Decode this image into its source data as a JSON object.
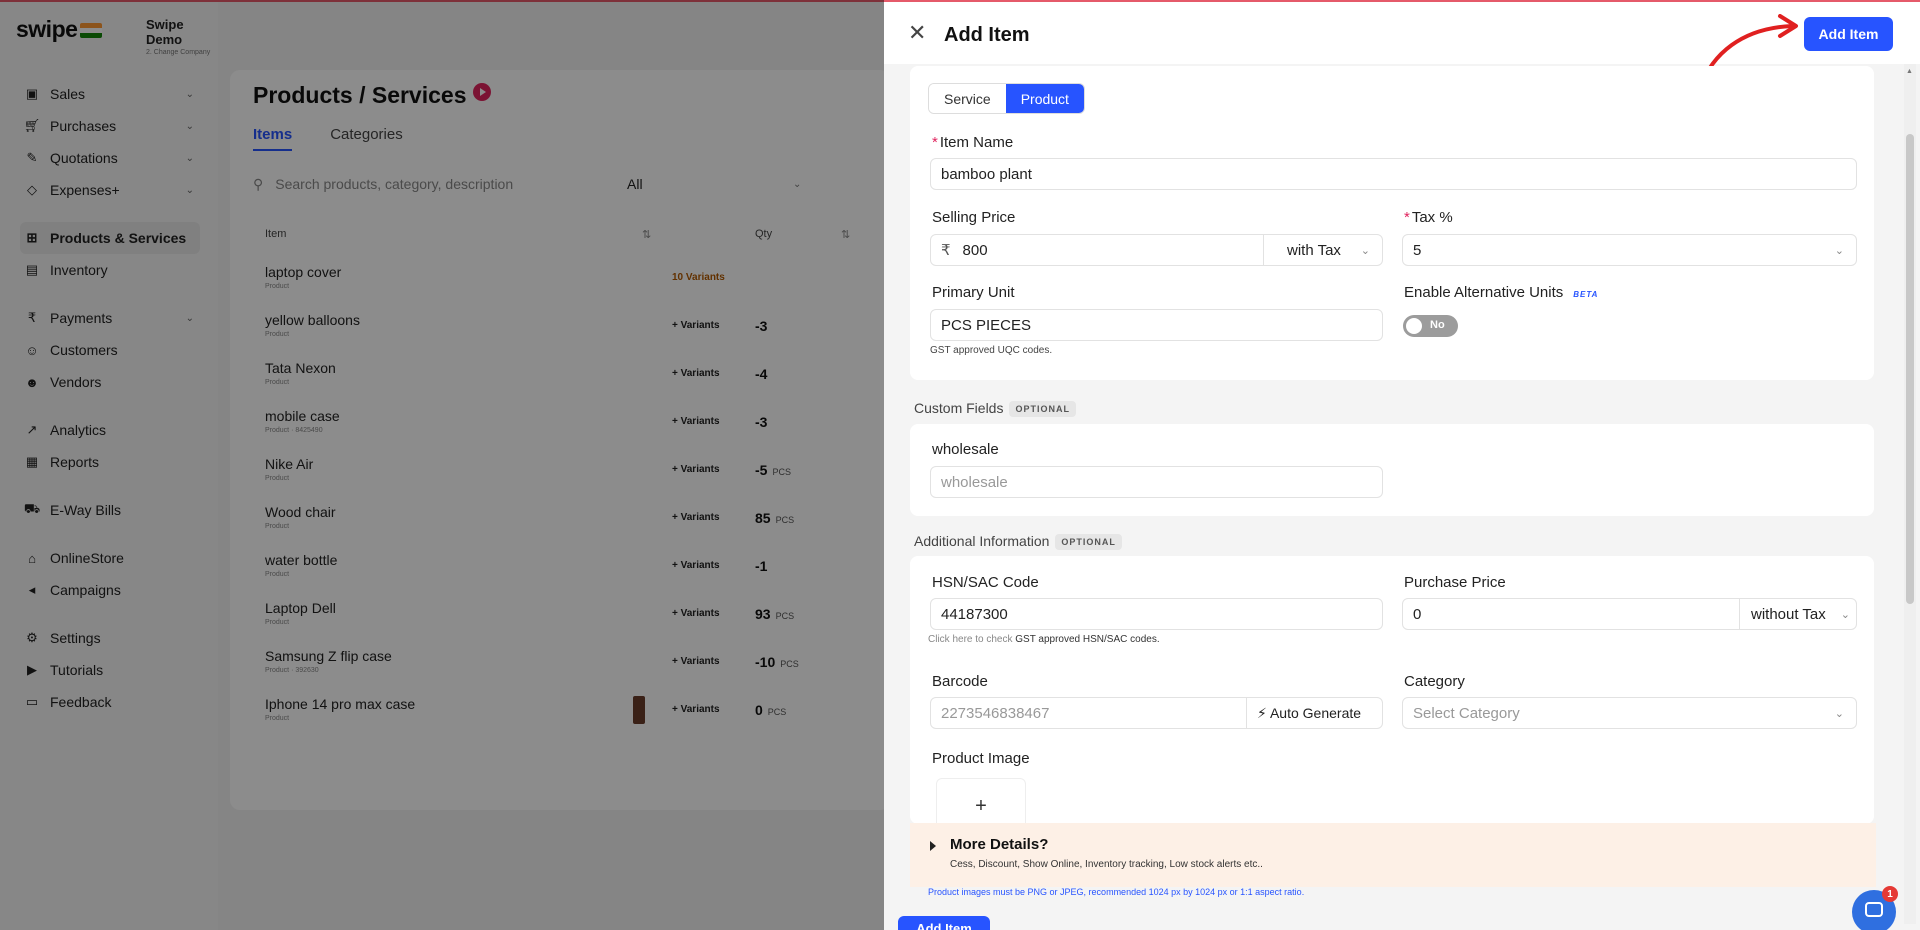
{
  "brand": {
    "logo": "swipe",
    "company_name": "Swipe Demo",
    "company_sub": "2. Change Company"
  },
  "sidebar": {
    "items": [
      {
        "label": "Sales",
        "icon": "sales-icon",
        "expand": true
      },
      {
        "label": "Purchases",
        "icon": "cart-icon",
        "expand": true
      },
      {
        "label": "Quotations",
        "icon": "pen-icon",
        "expand": true
      },
      {
        "label": "Expenses+",
        "icon": "tag-icon",
        "expand": true
      },
      {
        "label": "Products & Services",
        "icon": "products-icon",
        "active": true
      },
      {
        "label": "Inventory",
        "icon": "inventory-icon"
      },
      {
        "label": "Payments",
        "icon": "rupee-icon",
        "expand": true
      },
      {
        "label": "Customers",
        "icon": "user-icon"
      },
      {
        "label": "Vendors",
        "icon": "vendors-icon"
      },
      {
        "label": "Analytics",
        "icon": "analytics-icon"
      },
      {
        "label": "Reports",
        "icon": "reports-icon"
      },
      {
        "label": "E-Way Bills",
        "icon": "truck-icon"
      },
      {
        "label": "OnlineStore",
        "icon": "store-icon"
      },
      {
        "label": "Campaigns",
        "icon": "megaphone-icon"
      },
      {
        "label": "Settings",
        "icon": "gear-icon"
      },
      {
        "label": "Tutorials",
        "icon": "youtube-icon"
      },
      {
        "label": "Feedback",
        "icon": "chat-icon"
      }
    ]
  },
  "products_page": {
    "title": "Products / Services",
    "tabs": [
      "Items",
      "Categories"
    ],
    "search_placeholder": "Search products, category, description",
    "filter_value": "All",
    "columns": {
      "item": "Item",
      "qty": "Qty"
    },
    "rows": [
      {
        "name": "laptop cover",
        "sub": "Product",
        "variants": "10 Variants",
        "qty": "",
        "unit": ""
      },
      {
        "name": "yellow balloons",
        "sub": "Product",
        "variants": "+ Variants",
        "qty": "-3",
        "unit": ""
      },
      {
        "name": "Tata Nexon",
        "sub": "Product",
        "variants": "+ Variants",
        "qty": "-4",
        "unit": ""
      },
      {
        "name": "mobile case",
        "sub": "Product · 8425490",
        "variants": "+ Variants",
        "qty": "-3",
        "unit": ""
      },
      {
        "name": "Nike Air",
        "sub": "Product",
        "variants": "+ Variants",
        "qty": "-5",
        "unit": "PCS"
      },
      {
        "name": "Wood chair",
        "sub": "Product",
        "variants": "+ Variants",
        "qty": "85",
        "unit": "PCS"
      },
      {
        "name": "water bottle",
        "sub": "Product",
        "variants": "+ Variants",
        "qty": "-1",
        "unit": ""
      },
      {
        "name": "Laptop Dell",
        "sub": "Product",
        "variants": "+ Variants",
        "qty": "93",
        "unit": "PCS"
      },
      {
        "name": "Samsung Z flip case",
        "sub": "Product · 392630",
        "variants": "+ Variants",
        "qty": "-10",
        "unit": "PCS"
      },
      {
        "name": "Iphone 14 pro max case",
        "sub": "Product",
        "variants": "+ Variants",
        "qty": "0",
        "unit": "PCS",
        "thumb": true
      }
    ]
  },
  "drawer": {
    "title": "Add Item",
    "add_button": "Add Item",
    "type_toggle": {
      "options": [
        "Service",
        "Product"
      ],
      "selected": "Product"
    },
    "item_name": {
      "label": "Item Name",
      "value": "bamboo plant"
    },
    "selling_price": {
      "label": "Selling Price",
      "currency": "₹",
      "value": "800",
      "tax_mode": "with Tax"
    },
    "tax": {
      "label": "Tax %",
      "value": "5"
    },
    "primary_unit": {
      "label": "Primary Unit",
      "value": "PCS PIECES",
      "hint": "GST approved UQC codes."
    },
    "alt_units": {
      "label": "Enable Alternative Units",
      "badge": "BETA",
      "toggle_text": "No"
    },
    "custom_fields": {
      "title": "Custom Fields",
      "badge": "OPTIONAL",
      "field_label": "wholesale",
      "placeholder": "wholesale"
    },
    "additional": {
      "title": "Additional Information",
      "badge": "OPTIONAL",
      "hsn": {
        "label": "HSN/SAC Code",
        "value": "44187300",
        "hint_prefix": "Click here to check ",
        "hint_bold": "GST approved HSN/SAC codes."
      },
      "purchase_price": {
        "label": "Purchase Price",
        "value": "0",
        "tax_mode": "without Tax"
      },
      "barcode": {
        "label": "Barcode",
        "placeholder": "2273546838467",
        "auto_label": "Auto Generate"
      },
      "category": {
        "label": "Category",
        "placeholder": "Select Category"
      },
      "product_image": {
        "label": "Product Image",
        "add": "+",
        "note": "Product images must be PNG or JPEG, recommended 1024 px by 1024 px or 1:1 aspect ratio."
      }
    },
    "more_details": {
      "title": "More Details?",
      "subtitle": "Cess, Discount, Show Online, Inventory tracking, Low stock alerts etc.."
    },
    "bottom_button": "Add Item"
  },
  "chat_widget": {
    "badge": "1"
  },
  "colors": {
    "primary": "#2754ff",
    "accent": "#e0245e",
    "annotation_arrow": "#e02020"
  }
}
